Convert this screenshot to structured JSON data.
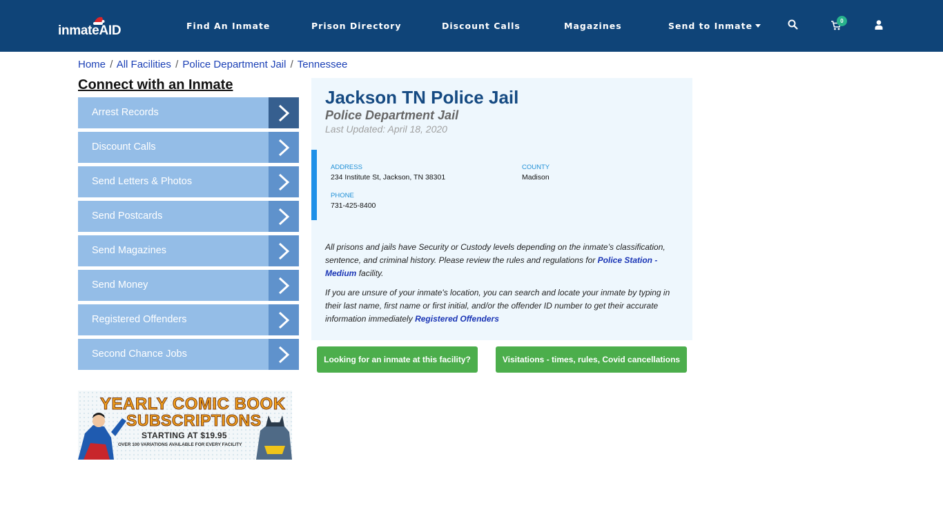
{
  "header": {
    "logo_text": "inmateAID",
    "nav": [
      {
        "label": "Find An Inmate"
      },
      {
        "label": "Prison Directory"
      },
      {
        "label": "Discount Calls"
      },
      {
        "label": "Magazines"
      },
      {
        "label": "Send to Inmate"
      }
    ],
    "cart_count": "0",
    "icons": [
      "search-icon",
      "cart-icon",
      "user-icon",
      "caret-down-icon"
    ]
  },
  "breadcrumb": [
    {
      "label": "Home"
    },
    {
      "label": "All Facilities"
    },
    {
      "label": "Police Department Jail"
    },
    {
      "label": "Tennessee"
    }
  ],
  "breadcrumb_separator": "/",
  "sidebar": {
    "title": "Connect with an Inmate",
    "items": [
      {
        "label": "Arrest Records"
      },
      {
        "label": "Discount Calls"
      },
      {
        "label": "Send Letters & Photos"
      },
      {
        "label": "Send Postcards"
      },
      {
        "label": "Send Magazines"
      },
      {
        "label": "Send Money"
      },
      {
        "label": "Registered Offenders"
      },
      {
        "label": "Second Chance Jobs"
      }
    ],
    "promo": {
      "line1": "YEARLY COMIC BOOK",
      "line2": "SUBSCRIPTIONS",
      "line3": "STARTING AT $19.95",
      "line4": "OVER 100 VARIATIONS AVAILABLE FOR EVERY FACILITY"
    }
  },
  "facility": {
    "title": "Jackson TN Police Jail",
    "type": "Police Department Jail",
    "updated": "Last Updated: April 18, 2020",
    "address_label": "ADDRESS",
    "address": "234 Institute St, Jackson, TN 38301",
    "county_label": "COUNTY",
    "county": "Madison",
    "phone_label": "PHONE",
    "phone": "731-425-8400",
    "para1_text": "All prisons and jails have Security or Custody levels depending on the inmate’s classification, sentence, and criminal history. Please review the rules and regulations for",
    "para1_link": "Police Station - Medium",
    "para1_tail": "facility.",
    "para2_text": "If you are unsure of your inmate's location, you can search and locate your inmate by typing in their last name, first name or first initial, and/or the offender ID number to get their accurate information immediately",
    "para2_link": "Registered Offenders"
  },
  "buttons": {
    "looking": "Looking for an inmate at this facility?",
    "visitation": "Visitations - times, rules, Covid cancellations"
  },
  "colors": {
    "header_bg": "#0f4478",
    "sidebar_item": "#94bde7",
    "sidebar_arrow": "#5f92cc",
    "sidebar_arrow_active": "#365f8f",
    "card_bg": "#eef7fd",
    "title": "#154a82",
    "button_green": "#4cae4c",
    "info_accent": "#1e90e8"
  }
}
